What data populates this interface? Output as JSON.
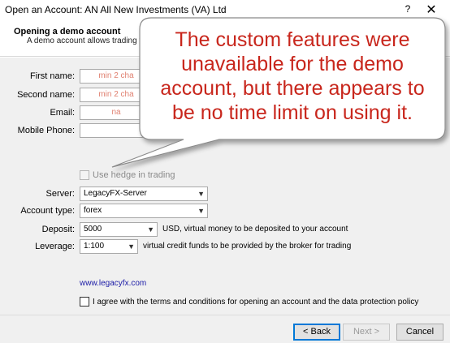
{
  "window": {
    "title": "Open an Account: AN All New Investments (VA) Ltd",
    "help_glyph": "?",
    "close_glyph": "✕"
  },
  "header": {
    "title": "Opening a demo account",
    "subtitle": "A demo account allows trading with"
  },
  "form": {
    "first_name": {
      "label": "First name:",
      "placeholder": "min 2 cha"
    },
    "second_name": {
      "label": "Second name:",
      "placeholder": "min 2 cha"
    },
    "email": {
      "label": "Email:",
      "placeholder": "na"
    },
    "mobile_phone": {
      "label": "Mobile Phone:",
      "value": ""
    },
    "hedge": {
      "label": "Use hedge in trading",
      "checked": false,
      "disabled": true
    },
    "server": {
      "label": "Server:",
      "value": "LegacyFX-Server"
    },
    "account_type": {
      "label": "Account type:",
      "value": "forex"
    },
    "deposit": {
      "label": "Deposit:",
      "value": "5000",
      "note": "USD, virtual money to be deposited to your account"
    },
    "leverage": {
      "label": "Leverage:",
      "value": "1:100",
      "note": "virtual credit funds to be provided by the broker for trading"
    }
  },
  "link": {
    "text": "www.legacyfx.com"
  },
  "agree": {
    "label": "I agree with the terms and conditions for opening an account and the data protection policy",
    "checked": false
  },
  "buttons": {
    "back": "< Back",
    "next": "Next >",
    "cancel": "Cancel"
  },
  "annotation": {
    "text": "The custom features were unavailable for the demo account, but there appears to be no time limit on using it.",
    "color": "#c8261c"
  },
  "icons": {
    "dropdown": "chevron-down-icon",
    "close": "close-icon",
    "help": "help-icon"
  }
}
